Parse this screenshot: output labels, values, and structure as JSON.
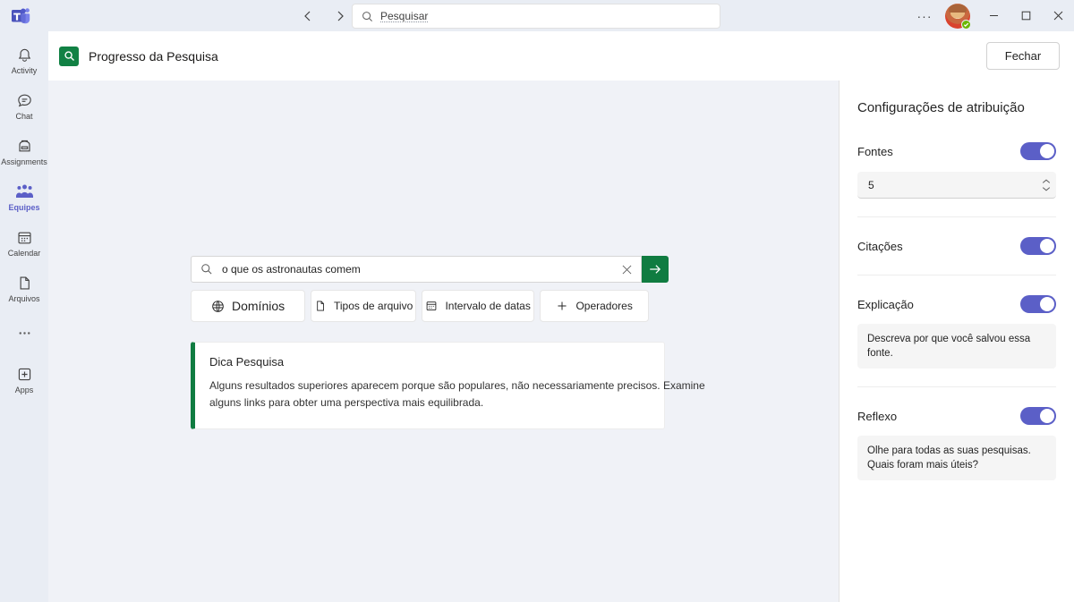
{
  "titlebar": {
    "logo_icon": "teams-logo",
    "back_icon": "chevron-left-icon",
    "forward_icon": "chevron-right-icon",
    "search_icon": "search-icon",
    "search_placeholder": "Pesquisar",
    "search_value": "",
    "more_label": "···",
    "avatar_name": "avatar",
    "presence_status": "available",
    "minimize_label": "─",
    "maximize_label": "□",
    "close_label": "✕"
  },
  "rail": {
    "items": [
      {
        "label": "Activity",
        "icon": "bell-icon",
        "active": false
      },
      {
        "label": "Chat",
        "icon": "chat-icon",
        "active": false
      },
      {
        "label": "Assignments",
        "icon": "backpack-icon",
        "active": false
      },
      {
        "label": "Equipes",
        "icon": "people-icon",
        "active": true
      },
      {
        "label": "Calendar",
        "icon": "calendar-icon",
        "active": false
      },
      {
        "label": "Arquivos",
        "icon": "file-icon",
        "active": false
      },
      {
        "label": "",
        "icon": "more-ellipsis-icon",
        "active": false
      },
      {
        "label": "Apps",
        "icon": "apps-plus-icon",
        "active": false
      }
    ]
  },
  "header": {
    "app_icon": "search-app-icon",
    "title": "Progresso da Pesquisa",
    "close_button": "Fechar"
  },
  "search": {
    "magnifier_icon": "search-icon",
    "query_value": "o que os astronautas comem",
    "clear_icon": "close-x-icon",
    "submit_icon": "arrow-right-icon",
    "filters": [
      {
        "label": "Domínios",
        "icon": "globe-icon"
      },
      {
        "label": "Tipos de arquivo",
        "icon": "document-icon"
      },
      {
        "label": "Intervalo de datas",
        "icon": "calendar-icon"
      },
      {
        "label": "Operadores",
        "icon": "plus-icon"
      }
    ]
  },
  "tip": {
    "title": "Dica Pesquisa",
    "body": "Alguns resultados superiores aparecem porque são populares, não necessariamente precisos. Examine alguns links para obter uma perspectiva mais equilibrada.",
    "accent_color": "#107C41"
  },
  "panel": {
    "title": "Configurações de atribuição",
    "toggle_on_color": "#5B5FC7",
    "settings": [
      {
        "label": "Fontes",
        "enabled": true,
        "spinner_value": "5",
        "description": null
      },
      {
        "label": "Citações",
        "enabled": true,
        "spinner_value": null,
        "description": null
      },
      {
        "label": "Explicação",
        "enabled": true,
        "spinner_value": null,
        "description": "Descreva por que você salvou essa fonte."
      },
      {
        "label": "Reflexo",
        "enabled": true,
        "spinner_value": null,
        "description": "Olhe para todas as suas pesquisas. Quais foram mais úteis?"
      }
    ]
  }
}
